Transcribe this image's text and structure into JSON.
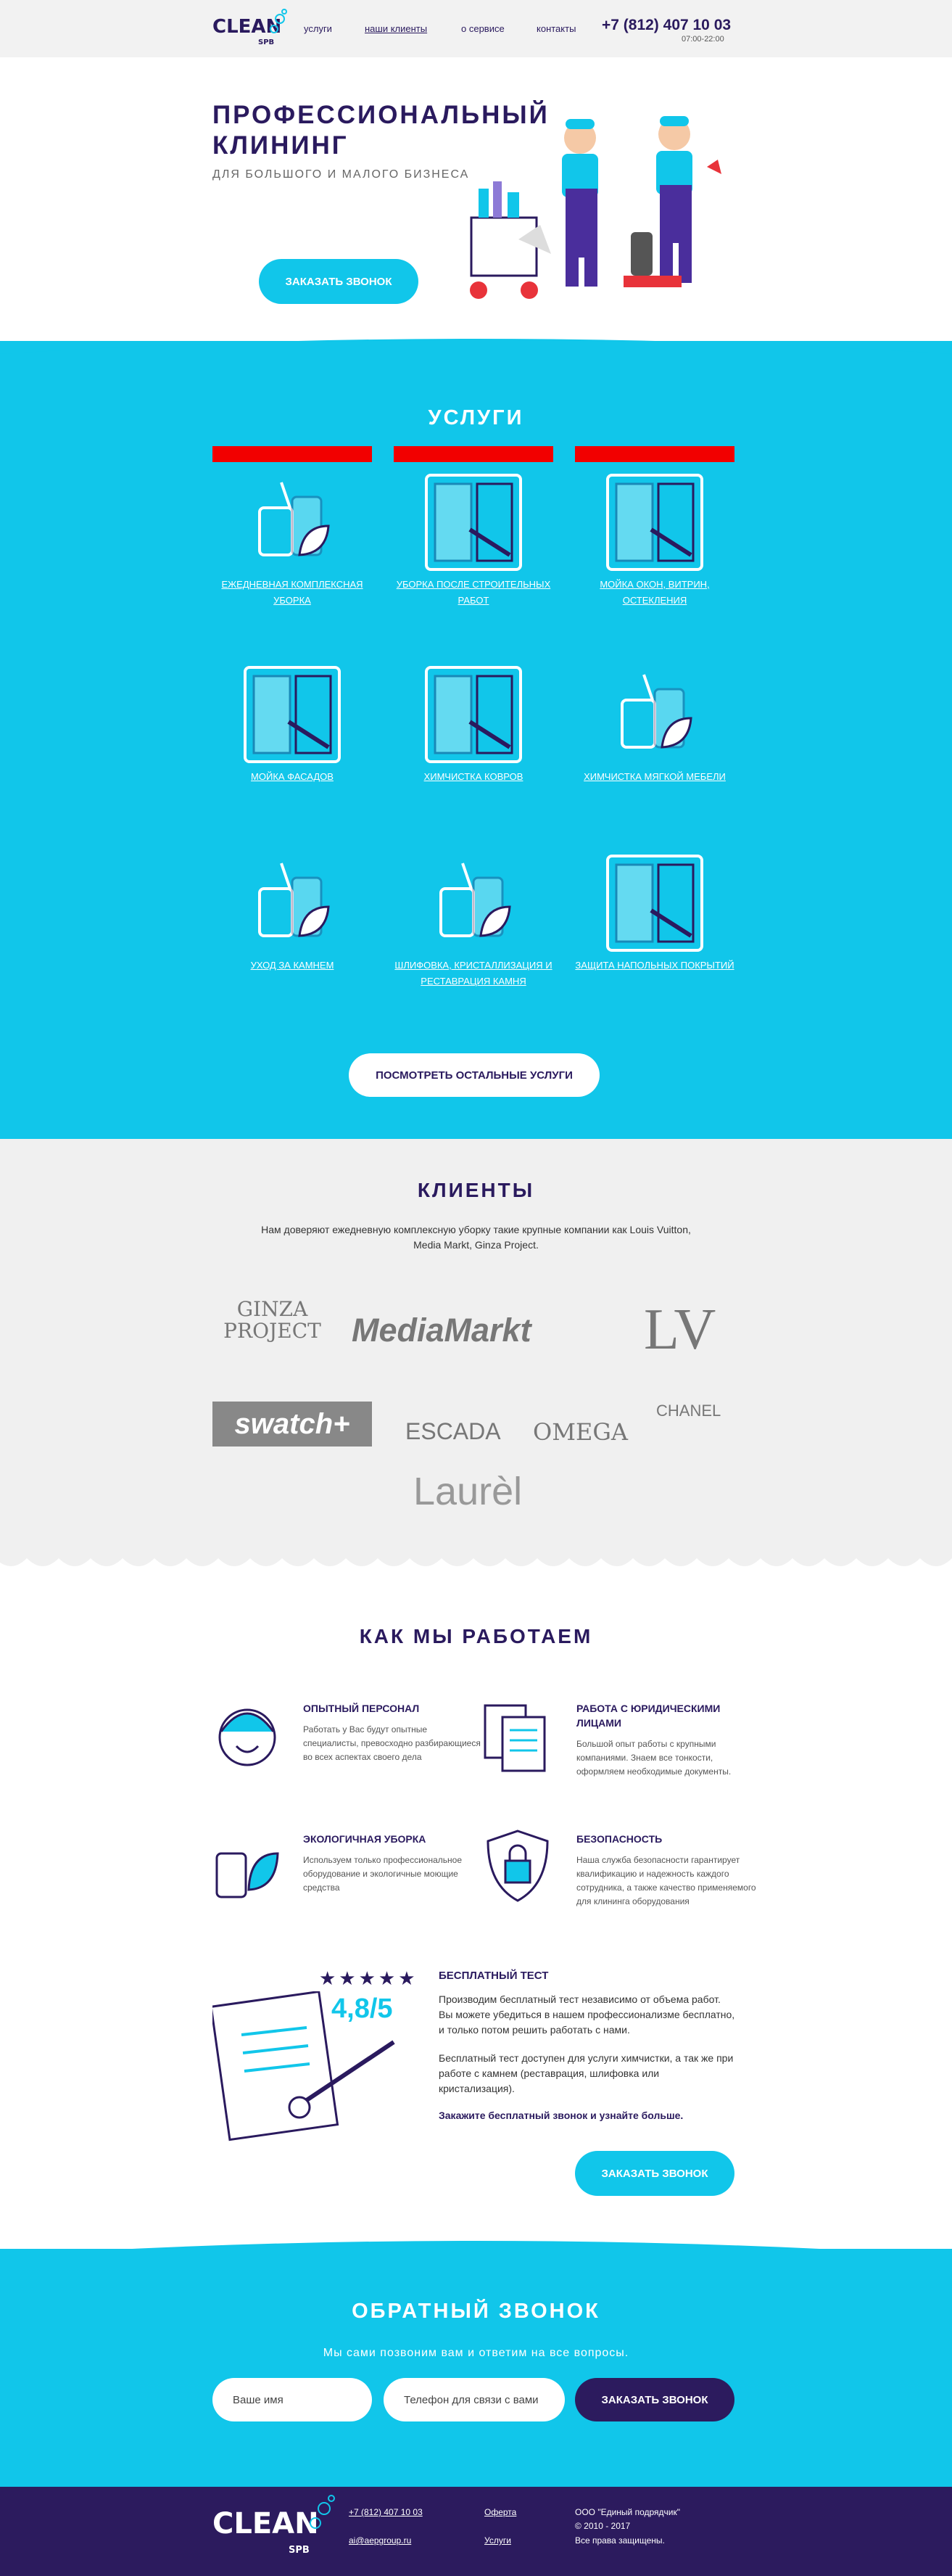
{
  "header": {
    "logo_text": "CLEAN",
    "logo_sub": "SPB",
    "nav": [
      "услуги",
      "наши клиенты",
      "о сервисе",
      "контакты"
    ],
    "phone": "+7 (812) 407 10 03",
    "hours": "07:00-22:00"
  },
  "hero": {
    "title": "ПРОФЕССИОНАЛЬНЫЙ КЛИНИНГ",
    "subtitle": "ДЛЯ БОЛЬШОГО И МАЛОГО БИЗНЕСА",
    "cta": "ЗАКАЗАТЬ ЗВОНОК"
  },
  "services": {
    "title": "УСЛУГИ",
    "items": [
      {
        "label": "ЕЖЕДНЕВНАЯ КОМПЛЕКСНАЯ УБОРКА",
        "icon": "bottles-icon"
      },
      {
        "label": "УБОРКА ПОСЛЕ СТРОИТЕЛЬНЫХ РАБОТ",
        "icon": "window-icon"
      },
      {
        "label": "МОЙКА ОКОН, ВИТРИН, ОСТЕКЛЕНИЯ",
        "icon": "window-icon"
      },
      {
        "label": "МОЙКА ФАСАДОВ",
        "icon": "window-icon"
      },
      {
        "label": "ХИМЧИСТКА КОВРОВ",
        "icon": "window-icon"
      },
      {
        "label": "ХИМЧИСТКА МЯГКОЙ МЕБЕЛИ",
        "icon": "bottles-icon"
      },
      {
        "label": "УХОД ЗА КАМНЕМ",
        "icon": "bottles-icon"
      },
      {
        "label": "ШЛИФОВКА, КРИСТАЛЛИЗАЦИЯ И РЕСТАВРАЦИЯ КАМНЯ",
        "icon": "bottles-icon"
      },
      {
        "label": "ЗАЩИТА НАПОЛЬНЫХ ПОКРЫТИЙ",
        "icon": "window-icon"
      }
    ],
    "more": "ПОСМОТРЕТЬ ОСТАЛЬНЫЕ УСЛУГИ"
  },
  "clients": {
    "title": "КЛИЕНТЫ",
    "text": "Нам доверяют ежедневную комплексную уборку такие крупные компании как Louis Vuitton, Media Markt, Ginza Project.",
    "brands": [
      "GINZA PROJECT",
      "MediaMarkt",
      "LV",
      "swatch+",
      "ESCADA",
      "OMEGA",
      "CHANEL",
      "Laurèl"
    ]
  },
  "how": {
    "title": "КАК МЫ РАБОТАЕМ",
    "features": [
      {
        "title": "ОПЫТНЫЙ ПЕРСОНАЛ",
        "text": "Работать у Вас будут опытные специалисты, превосходно разбирающиеся во всех аспектах своего дела",
        "icon": "worker-icon"
      },
      {
        "title": "РАБОТА С ЮРИДИЧЕСКИМИ ЛИЦАМИ",
        "text": "Большой опыт работы с крупными компаниями. Знаем все тонкости, оформляем необходимые документы.",
        "icon": "documents-icon"
      },
      {
        "title": "ЭКОЛОГИЧНАЯ УБОРКА",
        "text": "Используем только профессиональное оборудование и экологичные моющие средства",
        "icon": "eco-icon"
      },
      {
        "title": "БЕЗОПАСНОСТЬ",
        "text": "Наша служба безопасности гарантирует квалификацию и надежность каждого сотрудника, а также качество применяемого для клининга оборудования",
        "icon": "shield-lock-icon"
      }
    ],
    "test": {
      "title": "БЕСПЛАТНЫЙ ТЕСТ",
      "rating": "4,8/5",
      "stars": 5,
      "p1": "Производим бесплатный тест независимо от объема работ. Вы можете убедиться в нашем профессионализме бесплатно, и только потом решить работать с нами.",
      "p2": "Бесплатный тест доступен для услуги химчистки, а так же при работе с камнем (реставрация, шлифовка или кристализация).",
      "p3": "Закажите бесплатный звонок и узнайте больше.",
      "cta": "ЗАКАЗАТЬ ЗВОНОК"
    }
  },
  "callback": {
    "title": "ОБРАТНЫЙ ЗВОНОК",
    "text": "Мы сами позвоним вам и ответим на все вопросы.",
    "name_placeholder": "Ваше имя",
    "phone_placeholder": "Телефон для связи с вами",
    "cta": "ЗАКАЗАТЬ ЗВОНОК"
  },
  "footer": {
    "phone": "+7 (812) 407 10 03",
    "email": "ai@aepgroup.ru",
    "offer": "Оферта",
    "services": "Услуги",
    "company": "ООО \"Единый подрядчик\"",
    "years": "© 2010 - 2017",
    "rights": "Все права защищены."
  },
  "colors": {
    "accent": "#11c6ea",
    "dark": "#2a1a5e",
    "red": "#f20000"
  }
}
